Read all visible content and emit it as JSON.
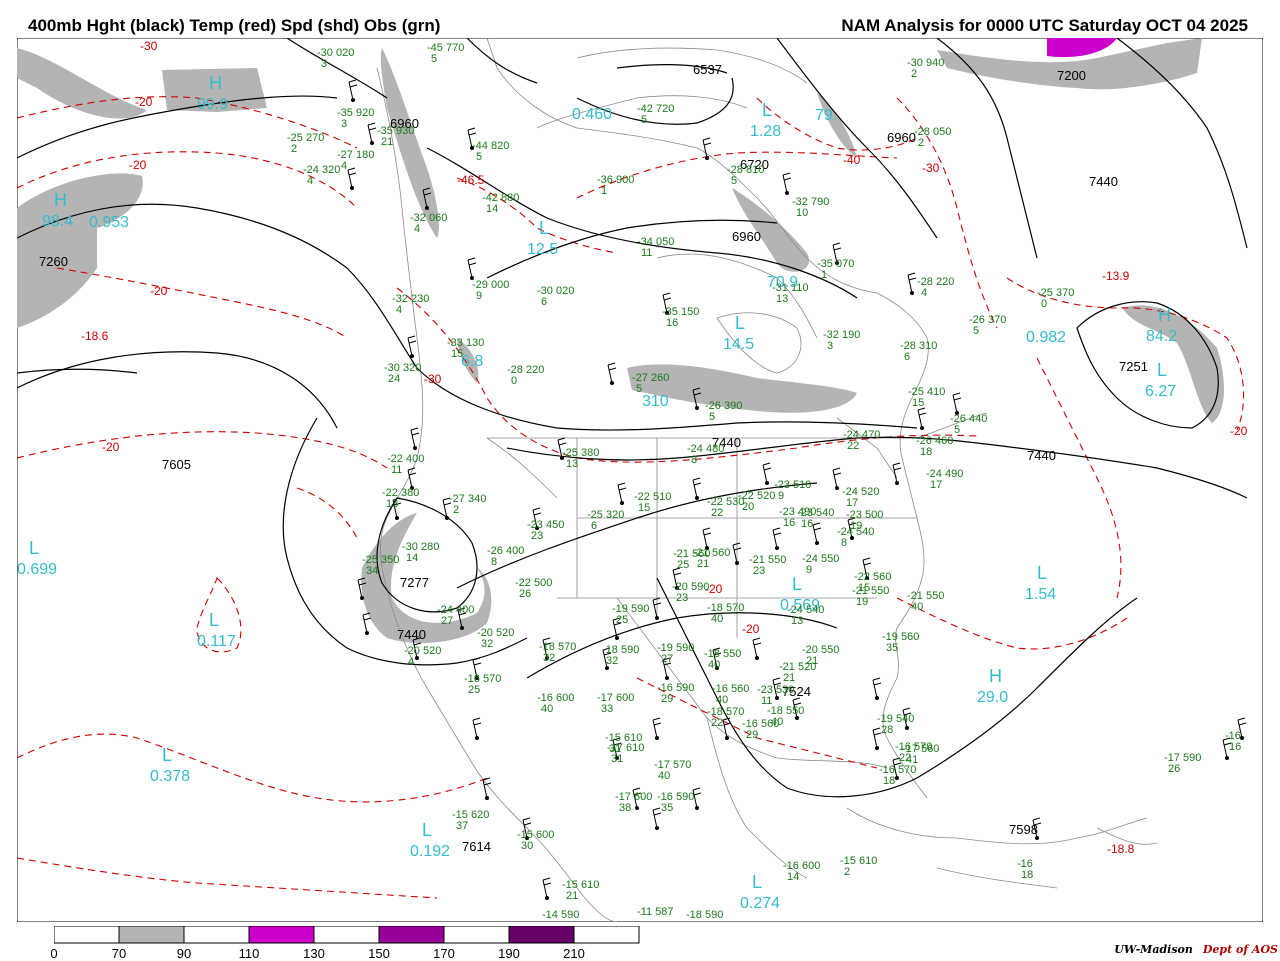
{
  "title": {
    "left": "400mb Hght (black) Temp (red) Spd (shd) Obs (grn)",
    "right": "NAM Analysis for 0000 UTC Saturday  OCT 04 2025"
  },
  "credit": {
    "org": "UW-Madison",
    "dept": "Dept of AOS"
  },
  "colors": {
    "height": "#000000",
    "temp": "#cc0000",
    "obs": "#1a7a1a",
    "center_label": "#33bbcc",
    "speed_70_90": "#b4b4b4",
    "speed_110_130": "#cc00cc",
    "speed_150_170": "#990099",
    "speed_190_210": "#660066"
  },
  "colorbar": {
    "ticks": [
      "0",
      "70",
      "90",
      "110",
      "130",
      "150",
      "170",
      "190",
      "210"
    ],
    "segments": [
      "#ffffff",
      "#b4b4b4",
      "#ffffff",
      "#cc00cc",
      "#ffffff",
      "#990099",
      "#ffffff",
      "#660066",
      "#ffffff"
    ]
  },
  "height_labels": [
    "7200",
    "6537",
    "6720",
    "6960",
    "6960",
    "7440",
    "7260",
    "6960",
    "7251",
    "7440",
    "7440",
    "7605",
    "7277",
    "7440",
    "7524",
    "7614",
    "7598"
  ],
  "temp_labels": [
    "-30",
    "-20",
    "-20",
    "-20",
    "-46.5",
    "-40",
    "-30",
    "-20",
    "-18.6",
    "-13.9",
    "-30",
    "-20",
    "-20",
    "-20",
    "-18.8"
  ],
  "center_labels": [
    {
      "sym": "H",
      "value": "99.9"
    },
    {
      "sym": "H",
      "value": "98.4"
    },
    {
      "sym": "",
      "value": "0.953"
    },
    {
      "sym": "",
      "value": "0.460"
    },
    {
      "sym": "L",
      "value": "1.28"
    },
    {
      "sym": "",
      "value": "79."
    },
    {
      "sym": "L",
      "value": "12.5"
    },
    {
      "sym": "L",
      "value": "14.5"
    },
    {
      "sym": "H",
      "value": "84.2"
    },
    {
      "sym": "L",
      "value": "6.27"
    },
    {
      "sym": "",
      "value": "0.982"
    },
    {
      "sym": "L",
      "value": "0.699"
    },
    {
      "sym": "L",
      "value": "0.117"
    },
    {
      "sym": "L",
      "value": "0.569"
    },
    {
      "sym": "L",
      "value": "1.54"
    },
    {
      "sym": "H",
      "value": "29.0"
    },
    {
      "sym": "L",
      "value": "0.378"
    },
    {
      "sym": "L",
      "value": "0.192"
    },
    {
      "sym": "L",
      "value": "0.274"
    },
    {
      "sym": "",
      "value": "6.8"
    },
    {
      "sym": "",
      "value": "310"
    },
    {
      "sym": "",
      "value": "70.9"
    }
  ],
  "observations": [
    {
      "t": "-30",
      "h": "020",
      "d": "3"
    },
    {
      "t": "-45",
      "h": "770",
      "d": "5"
    },
    {
      "t": "-42",
      "h": "720",
      "d": "5"
    },
    {
      "t": "-30",
      "h": "940",
      "d": "2"
    },
    {
      "t": "-35",
      "h": "920",
      "d": "3"
    },
    {
      "t": "-35",
      "h": "930",
      "d": "21"
    },
    {
      "t": "-25",
      "h": "270",
      "d": "2"
    },
    {
      "t": "-27",
      "h": "180",
      "d": "4"
    },
    {
      "t": "-24",
      "h": "320",
      "d": "4"
    },
    {
      "t": "-44",
      "h": "820",
      "d": "5"
    },
    {
      "t": "-42",
      "h": "880",
      "d": "14"
    },
    {
      "t": "-36",
      "h": "900",
      "d": "1"
    },
    {
      "t": "-28",
      "h": "810",
      "d": "5"
    },
    {
      "t": "-28",
      "h": "050",
      "d": "2"
    },
    {
      "t": "-32",
      "h": "790",
      "d": "10"
    },
    {
      "t": "-32",
      "h": "060",
      "d": "4"
    },
    {
      "t": "-34",
      "h": "050",
      "d": "11"
    },
    {
      "t": "-29",
      "h": "000",
      "d": "9"
    },
    {
      "t": "-30",
      "h": "020",
      "d": "6"
    },
    {
      "t": "-32",
      "h": "230",
      "d": "4"
    },
    {
      "t": "-33",
      "h": "130",
      "d": "15"
    },
    {
      "t": "-31",
      "h": "110",
      "d": "13"
    },
    {
      "t": "-35",
      "h": "070",
      "d": "1"
    },
    {
      "t": "-28",
      "h": "220",
      "d": "4"
    },
    {
      "t": "-35",
      "h": "150",
      "d": "16"
    },
    {
      "t": "-32",
      "h": "190",
      "d": "3"
    },
    {
      "t": "-26",
      "h": "370",
      "d": "5"
    },
    {
      "t": "-25",
      "h": "370",
      "d": "0"
    },
    {
      "t": "-28",
      "h": "310",
      "d": "6"
    },
    {
      "t": "-30",
      "h": "320",
      "d": "24"
    },
    {
      "t": "-28",
      "h": "220",
      "d": "0"
    },
    {
      "t": "-27",
      "h": "260",
      "d": "5"
    },
    {
      "t": "-26",
      "h": "390",
      "d": "5"
    },
    {
      "t": "-25",
      "h": "410",
      "d": "15"
    },
    {
      "t": "-26",
      "h": "440",
      "d": "5"
    },
    {
      "t": "-24",
      "h": "470",
      "d": "22"
    },
    {
      "t": "-26",
      "h": "460",
      "d": "18"
    },
    {
      "t": "-22",
      "h": "400",
      "d": "11"
    },
    {
      "t": "-22",
      "h": "380",
      "d": "13"
    },
    {
      "t": "-25",
      "h": "380",
      "d": "13"
    },
    {
      "t": "-24",
      "h": "480",
      "d": "8"
    },
    {
      "t": "-24",
      "h": "490",
      "d": "17"
    },
    {
      "t": "-27",
      "h": "340",
      "d": "2"
    },
    {
      "t": "-22",
      "h": "510",
      "d": "15"
    },
    {
      "t": "-22",
      "h": "530",
      "d": "22"
    },
    {
      "t": "-22",
      "h": "520",
      "d": "20"
    },
    {
      "t": "-23",
      "h": "510",
      "d": "9"
    },
    {
      "t": "-24",
      "h": "520",
      "d": "17"
    },
    {
      "t": "-23",
      "h": "500",
      "d": "19"
    },
    {
      "t": "-23",
      "h": "490",
      "d": "16"
    },
    {
      "t": "-23",
      "h": "450",
      "d": "23"
    },
    {
      "t": "-25",
      "h": "320",
      "d": "6"
    },
    {
      "t": "-26",
      "h": "400",
      "d": "8"
    },
    {
      "t": "-30",
      "h": "280",
      "d": "14"
    },
    {
      "t": "-25",
      "h": "350",
      "d": "34"
    },
    {
      "t": "-23",
      "h": "540",
      "d": "16"
    },
    {
      "t": "-24",
      "h": "540",
      "d": "8"
    },
    {
      "t": "-21",
      "h": "560",
      "d": "21"
    },
    {
      "t": "-21",
      "h": "560",
      "d": "25"
    },
    {
      "t": "-21",
      "h": "550",
      "d": "23"
    },
    {
      "t": "-24",
      "h": "550",
      "d": "9"
    },
    {
      "t": "-22",
      "h": "500",
      "d": "26"
    },
    {
      "t": "-22",
      "h": "560",
      "d": "15"
    },
    {
      "t": "-21",
      "h": "550",
      "d": "19"
    },
    {
      "t": "-21",
      "h": "550",
      "d": "40"
    },
    {
      "t": "-20",
      "h": "590",
      "d": "23"
    },
    {
      "t": "-18",
      "h": "570",
      "d": "40"
    },
    {
      "t": "-19",
      "h": "590",
      "d": "25"
    },
    {
      "t": "-24",
      "h": "400",
      "d": "27"
    },
    {
      "t": "-20",
      "h": "520",
      "d": "32"
    },
    {
      "t": "-18",
      "h": "570",
      "d": "32"
    },
    {
      "t": "-18",
      "h": "590",
      "d": "32"
    },
    {
      "t": "-19",
      "h": "590",
      "d": "27"
    },
    {
      "t": "-24",
      "h": "540",
      "d": "13"
    },
    {
      "t": "-20",
      "h": "550",
      "d": "21"
    },
    {
      "t": "-19",
      "h": "560",
      "d": "35"
    },
    {
      "t": "-18",
      "h": "550",
      "d": "40"
    },
    {
      "t": "-21",
      "h": "520",
      "d": "21"
    },
    {
      "t": "-20",
      "h": "520",
      "d": "4"
    },
    {
      "t": "-16",
      "h": "570",
      "d": "25"
    },
    {
      "t": "-16",
      "h": "600",
      "d": "40"
    },
    {
      "t": "-17",
      "h": "600",
      "d": "33"
    },
    {
      "t": "-16",
      "h": "590",
      "d": "29"
    },
    {
      "t": "-16",
      "h": "560",
      "d": "40"
    },
    {
      "t": "-23",
      "h": "530",
      "d": "11"
    },
    {
      "t": "-18",
      "h": "570",
      "d": "22"
    },
    {
      "t": "-16",
      "h": "560",
      "d": "29"
    },
    {
      "t": "-18",
      "h": "550",
      "d": "40"
    },
    {
      "t": "-19",
      "h": "540",
      "d": "28"
    },
    {
      "t": "-17",
      "h": "560",
      "d": "41"
    },
    {
      "t": "-16",
      "h": "570",
      "d": "22"
    },
    {
      "t": "-16",
      "h": "570",
      "d": "18"
    },
    {
      "t": "-15",
      "h": "610",
      "d": "31"
    },
    {
      "t": "-17",
      "h": "610",
      "d": "31"
    },
    {
      "t": "-17",
      "h": "570",
      "d": "40"
    },
    {
      "t": "-17",
      "h": "600",
      "d": "38"
    },
    {
      "t": "-16",
      "h": "590",
      "d": "35"
    },
    {
      "t": "-15",
      "h": "620",
      "d": "37"
    },
    {
      "t": "-15",
      "h": "600",
      "d": "30"
    },
    {
      "t": "-16",
      "h": "600",
      "d": "14"
    },
    {
      "t": "-15",
      "h": "610",
      "d": "2"
    },
    {
      "t": "-15",
      "h": "610",
      "d": "21"
    },
    {
      "t": "-14",
      "h": "590",
      "d": ""
    },
    {
      "t": "-11",
      "h": "587",
      "d": ""
    },
    {
      "t": "-18",
      "h": "590",
      "d": ""
    },
    {
      "t": "-17",
      "h": "590",
      "d": "26"
    },
    {
      "t": "-16",
      "h": "",
      "d": "18"
    },
    {
      "t": "-16",
      "h": "",
      "d": "16"
    }
  ]
}
